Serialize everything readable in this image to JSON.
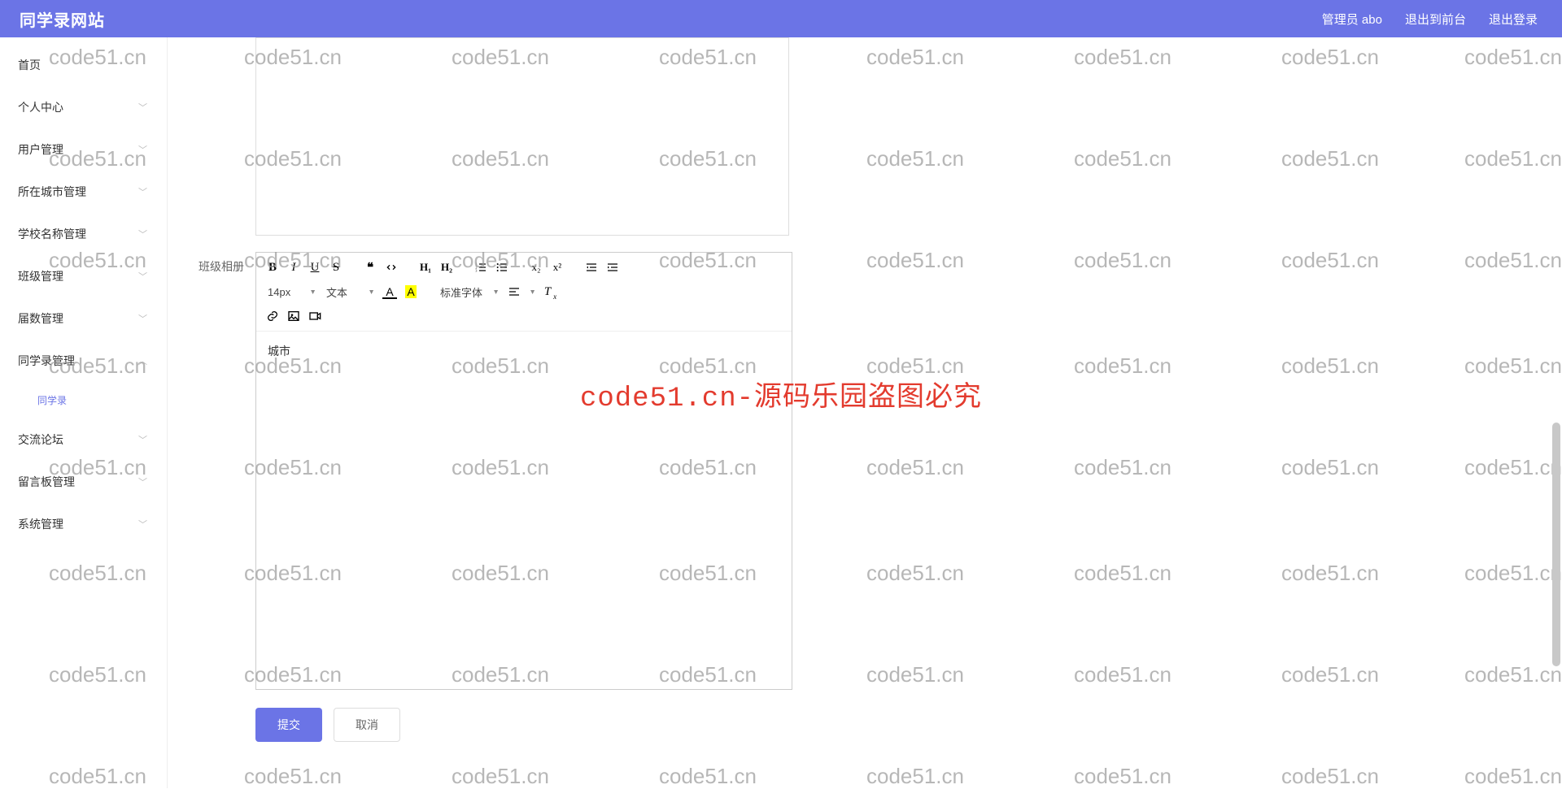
{
  "header": {
    "brand": "同学录网站",
    "admin_label": "管理员 abo",
    "exit_front": "退出到前台",
    "logout": "退出登录"
  },
  "sidebar": {
    "items": [
      {
        "label": "首页",
        "expandable": false
      },
      {
        "label": "个人中心",
        "expandable": true
      },
      {
        "label": "用户管理",
        "expandable": true
      },
      {
        "label": "所在城市管理",
        "expandable": true
      },
      {
        "label": "学校名称管理",
        "expandable": true
      },
      {
        "label": "班级管理",
        "expandable": true
      },
      {
        "label": "届数管理",
        "expandable": true
      },
      {
        "label": "同学录管理",
        "expandable": true,
        "expanded": true,
        "children": [
          {
            "label": "同学录"
          }
        ]
      },
      {
        "label": "交流论坛",
        "expandable": true
      },
      {
        "label": "留言板管理",
        "expandable": true
      },
      {
        "label": "系统管理",
        "expandable": true
      }
    ]
  },
  "form": {
    "album_label": "班级相册",
    "editor_content": "城市",
    "toolbar": {
      "bold": "B",
      "italic": "I",
      "underline": "U",
      "strike": "S",
      "h1": "H₁",
      "h2": "H₂",
      "sub": "x₂",
      "sup": "x²",
      "size_label": "14px",
      "format_label": "文本",
      "font_label": "标准字体",
      "link_icon": "link",
      "image_icon": "image",
      "video_icon": "video"
    },
    "submit_label": "提交",
    "cancel_label": "取消"
  },
  "watermark": {
    "text": "code51.cn",
    "center": "code51.cn-源码乐园盗图必究"
  }
}
